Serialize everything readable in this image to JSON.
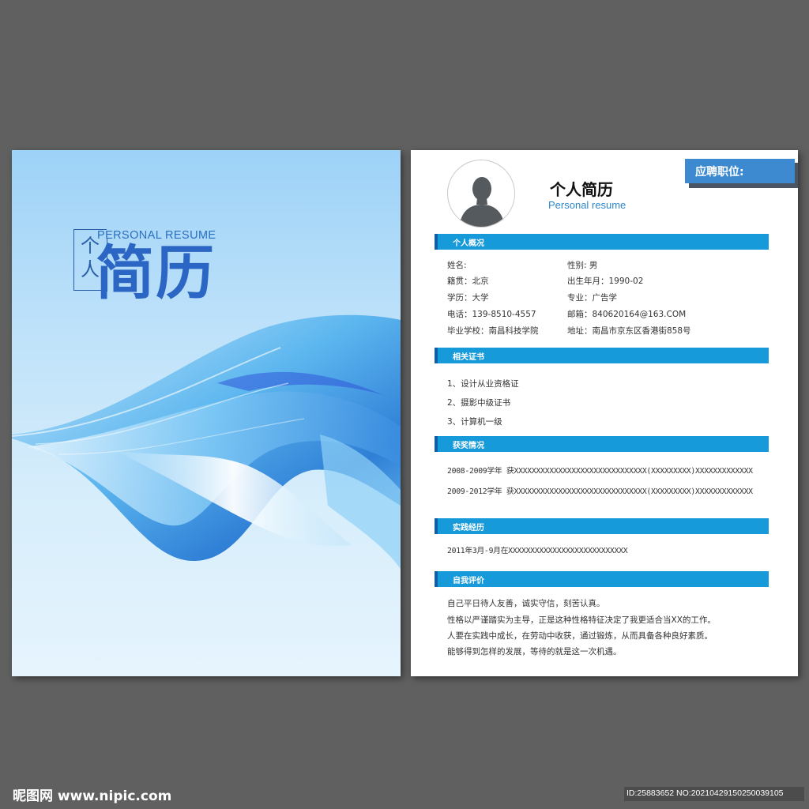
{
  "cover": {
    "title_small": "个人",
    "title_en": "PERSONAL RESUME",
    "title_big": "简历"
  },
  "resume": {
    "title_cn": "个人简历",
    "title_en": "Personal resume",
    "apply_label": "应聘职位:",
    "sections": {
      "overview": "个人概况",
      "certificates": "相关证书",
      "awards": "获奖情况",
      "practice": "实践经历",
      "evaluation": "自我评价"
    },
    "overview": {
      "name": "姓名:",
      "gender": "性别:   男",
      "origin": "籍贯：北京",
      "birth": "出生年月：1990-02",
      "education": "学历：大学",
      "major": "专业：广告学",
      "phone": "电话：139-8510-4557",
      "email": "邮箱：840620164@163.COM",
      "school": "毕业学校：南昌科技学院",
      "address": "地址：南昌市京东区香港街858号"
    },
    "certificates": [
      "1、设计从业资格证",
      "2、摄影中级证书",
      "3、计算机一级"
    ],
    "awards": [
      "2008-2009学年  获XXXXXXXXXXXXXXXXXXXXXXXXXXXXXX(XXXXXXXXX)XXXXXXXXXXXXX",
      "2009-2012学年  获XXXXXXXXXXXXXXXXXXXXXXXXXXXXXX(XXXXXXXXX)XXXXXXXXXXXXX"
    ],
    "practice": [
      "2011年3月-9月在XXXXXXXXXXXXXXXXXXXXXXXXXXX"
    ],
    "evaluation": [
      "自己平日待人友善，诚实守信，刻苦认真。",
      "性格以严谨踏实为主导，正是这种性格特征决定了我更适合当XX的工作。",
      "人要在实践中成长，在劳动中收获，通过锻炼，从而具备各种良好素质。",
      "能够得到怎样的发展，等待的就是这一次机遇。"
    ]
  },
  "watermark": {
    "left": "昵图网 www.nipic.com",
    "right": "ID:25883652 NO:20210429150250039105"
  },
  "colors": {
    "background": "#5f605f",
    "section_bar": "#179ad9",
    "apply_box": "#3d8ad0",
    "cover_title": "#2c66c4"
  },
  "icons": [
    "avatar-silhouette-icon"
  ]
}
